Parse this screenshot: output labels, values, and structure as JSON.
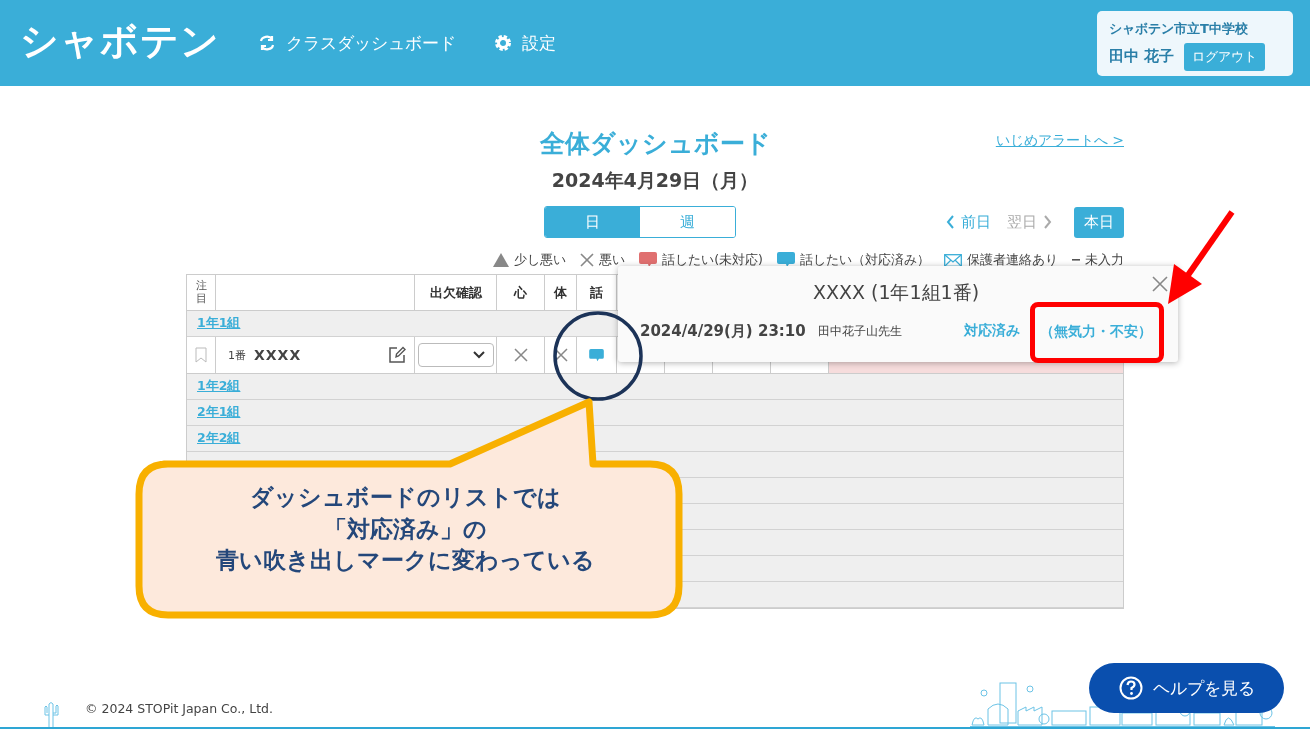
{
  "header": {
    "logo": "シャボテン",
    "nav": [
      {
        "kind": "swap",
        "label": "クラスダッシュボード"
      },
      {
        "kind": "gear",
        "label": "設定"
      }
    ],
    "user": {
      "school": "シャボテン市立T中学校",
      "name": "田中 花子",
      "logout": "ログアウト"
    }
  },
  "title": "全体ダッシュボード",
  "alert_link": "いじめアラートへ >",
  "date": "2024年4月29日（月）",
  "view_tabs": [
    {
      "label": "日",
      "selected": true
    },
    {
      "label": "週",
      "selected": false
    }
  ],
  "day_nav": [
    {
      "kind": "prev",
      "label": "前日",
      "disabled": false
    },
    {
      "kind": "next",
      "label": "翌日",
      "disabled": true
    }
  ],
  "today_button": "本日",
  "legend": [
    {
      "kind": "triangle",
      "label": "少し悪い"
    },
    {
      "kind": "cross",
      "label": "悪い"
    },
    {
      "kind": "bubble",
      "color": "#e07070",
      "label": "話したい(未対応)"
    },
    {
      "kind": "bubble",
      "color": "#3aaed8",
      "label": "話したい（対応済み）"
    },
    {
      "kind": "mail",
      "label": "保護者連絡あり"
    },
    {
      "kind": "dash",
      "label": "未入力"
    }
  ],
  "table": {
    "columns": [
      "注目",
      "",
      "出欠確認",
      "心",
      "体",
      "話"
    ],
    "groups": [
      {
        "label": "1年1組",
        "students": [
          {
            "bookmarked": false,
            "number": "1番",
            "name": "XXXX",
            "marks": [
              {
                "kind": "cross"
              },
              {
                "kind": "cross"
              },
              {
                "kind": "bubble",
                "color": "#3aaed8"
              }
            ]
          }
        ]
      },
      {
        "label": "1年2組"
      },
      {
        "label": "2年1組"
      },
      {
        "label": "2年2組"
      }
    ]
  },
  "popup": {
    "title": "XXXX (1年1組1番)",
    "datetime": "2024/4/29(月) 23:10",
    "teacher": "田中花子山先生",
    "status": "対応済み",
    "reason": "（無気力・不安）"
  },
  "callout": {
    "lines": [
      "ダッシュボードのリストでは",
      "「対応済み」の",
      "青い吹き出しマークに変わっている"
    ]
  },
  "footer": {
    "copyright": "© 2024 STOPit Japan Co., Ltd.",
    "help_button": "ヘルプを見る"
  }
}
